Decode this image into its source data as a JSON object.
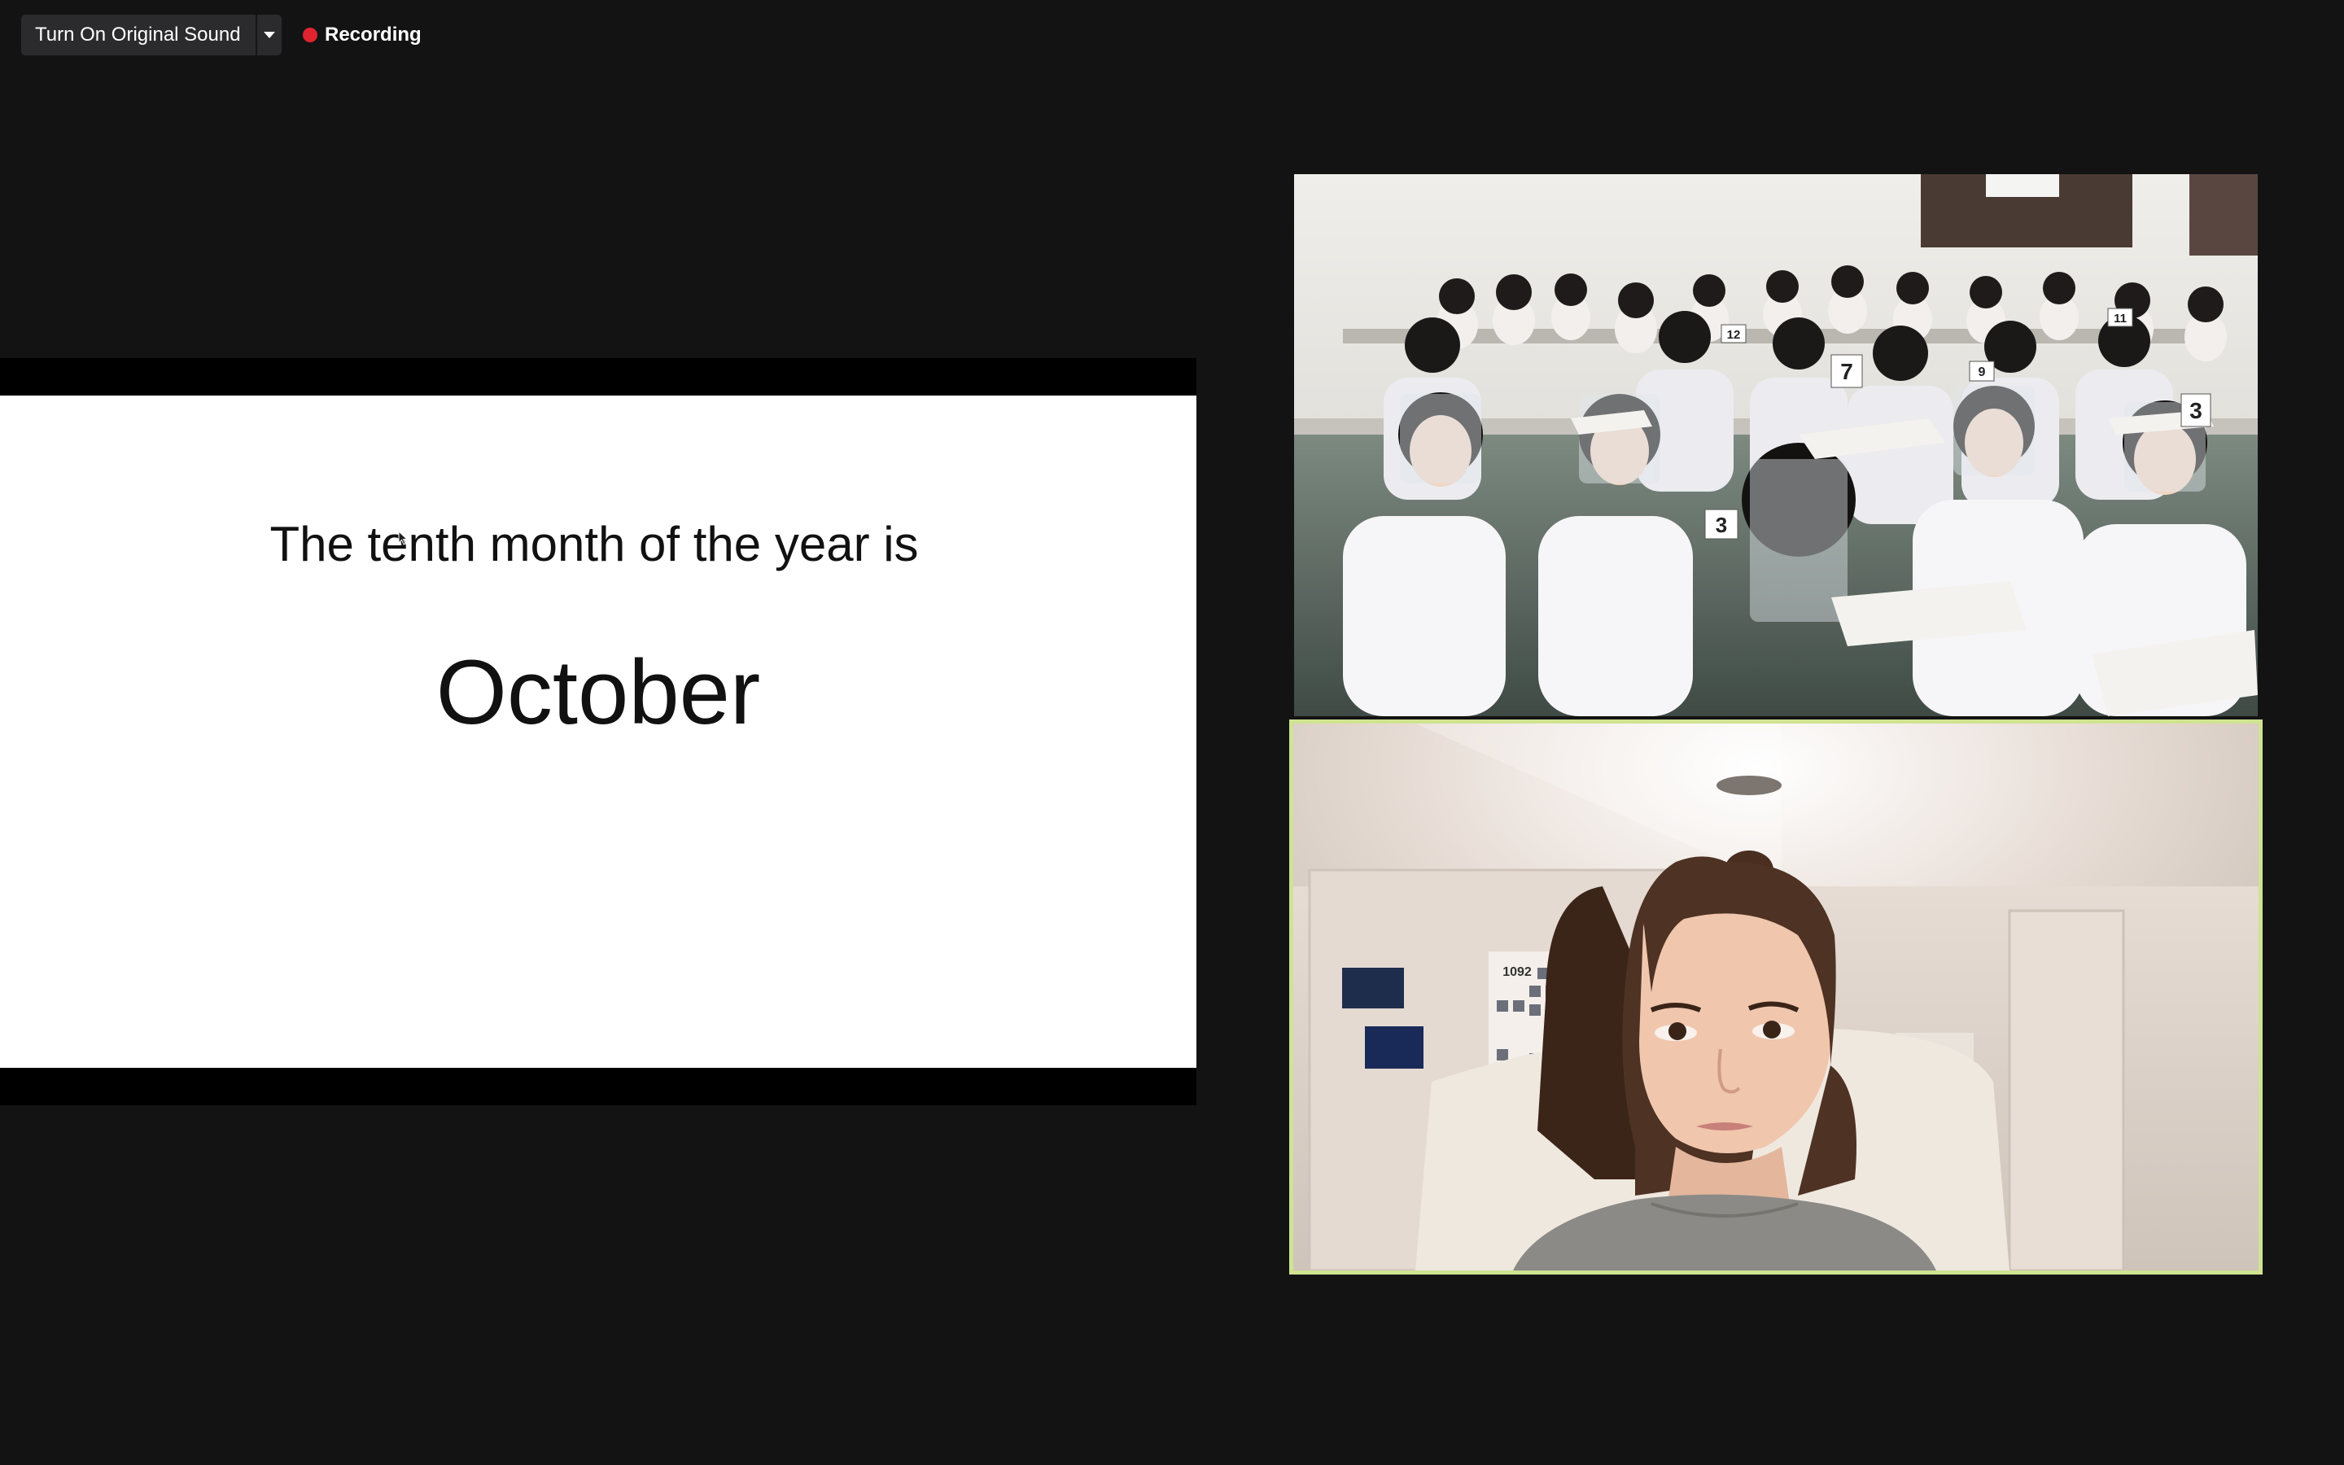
{
  "toolbar": {
    "original_sound_label": "Turn On Original Sound",
    "original_sound_menu_icon": "chevron-down-icon",
    "recording_label": "Recording",
    "recording_color": "#e0242f"
  },
  "shared_screen": {
    "slide": {
      "prompt": "The tenth month of the year is",
      "answer": "October"
    }
  },
  "participants": {
    "classroom": {
      "active_speaker": false,
      "desk_numbers": [
        "12",
        "11",
        "7",
        "9",
        "3",
        "3"
      ]
    },
    "teacher": {
      "active_speaker": true,
      "highlight_color": "#cfe390",
      "poster_number": "1092"
    }
  }
}
